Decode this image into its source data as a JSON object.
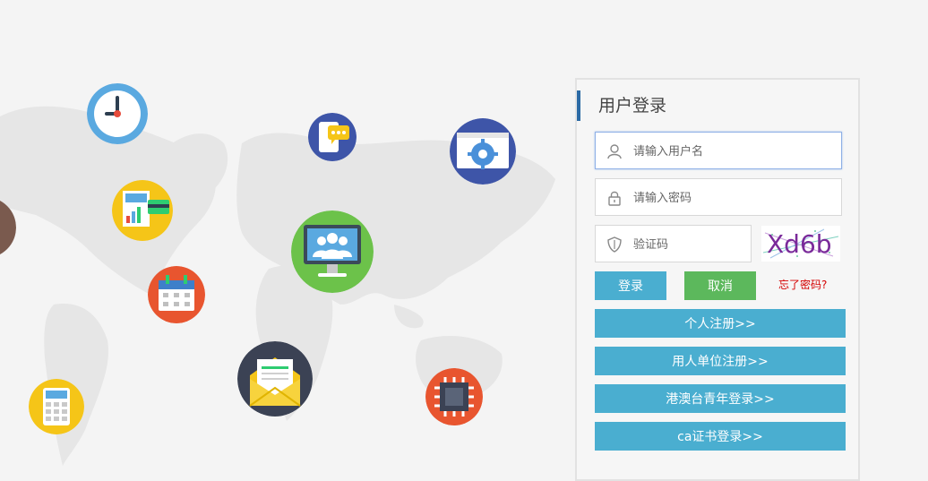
{
  "login": {
    "title": "用户登录",
    "username_placeholder": "请输入用户名",
    "password_placeholder": "请输入密码",
    "captcha_placeholder": "验证码",
    "captcha_text": "Xd6b",
    "login_label": "登录",
    "cancel_label": "取消",
    "forgot_label": "忘了密码?",
    "register_personal_label": "个人注册>>",
    "register_employer_label": "用人单位注册>>",
    "hk_macao_tw_label": "港澳台青年登录>>",
    "ca_login_label": "ca证书登录>>"
  },
  "colors": {
    "accent_blue": "#4aaed0",
    "cancel_green": "#5cb85c",
    "title_bar": "#2b6aa5",
    "forgot_red": "#d40000"
  },
  "icons": [
    "clock-icon",
    "chat-icon",
    "settings-monitor-icon",
    "report-icon",
    "team-monitor-icon",
    "calendar-icon",
    "email-icon",
    "chip-icon",
    "calculator-icon",
    "user-icon",
    "lock-icon",
    "shield-icon"
  ]
}
